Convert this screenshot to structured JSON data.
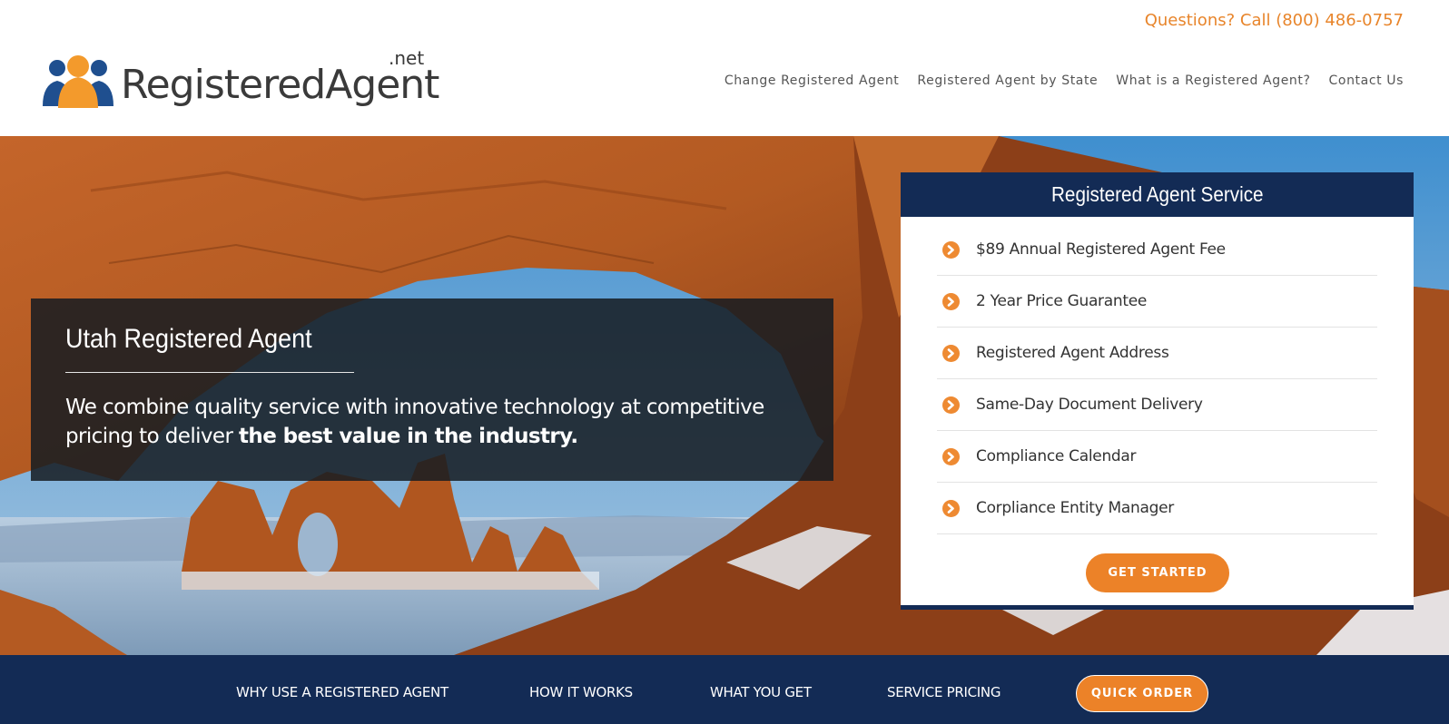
{
  "header": {
    "phone": "Questions? Call (800) 486-0757",
    "logo": {
      "name": "RegisteredAgent",
      "tld": ".net"
    },
    "nav": [
      {
        "label": "Change Registered Agent"
      },
      {
        "label": "Registered Agent by State"
      },
      {
        "label": "What is a Registered Agent?"
      },
      {
        "label": "Contact Us"
      }
    ]
  },
  "hero": {
    "title": "Utah Registered Agent",
    "text_regular": "We combine quality service with innovative technology at competitive pricing to deliver ",
    "text_bold": "the best value in the industry."
  },
  "service_card": {
    "title": "Registered Agent Service",
    "items": [
      {
        "icon": "chevron-circle-right-icon",
        "label": "$89 Annual Registered Agent Fee"
      },
      {
        "icon": "chevron-circle-right-icon",
        "label": "2 Year Price Guarantee"
      },
      {
        "icon": "chevron-circle-right-icon",
        "label": "Registered Agent Address"
      },
      {
        "icon": "chevron-circle-right-icon",
        "label": "Same-Day Document Delivery"
      },
      {
        "icon": "chevron-circle-right-icon",
        "label": "Compliance Calendar"
      },
      {
        "icon": "chevron-circle-right-icon",
        "label": "Corpliance Entity Manager"
      }
    ],
    "cta": "GET STARTED"
  },
  "bottom_nav": {
    "items": [
      {
        "label": "WHY USE A REGISTERED AGENT"
      },
      {
        "label": "HOW IT WORKS"
      },
      {
        "label": "WHAT YOU GET"
      },
      {
        "label": "SERVICE PRICING"
      }
    ],
    "cta": "QUICK ORDER"
  },
  "colors": {
    "brand_orange": "#ec8228",
    "brand_navy": "#132b55",
    "phone_orange": "#e8852b"
  }
}
